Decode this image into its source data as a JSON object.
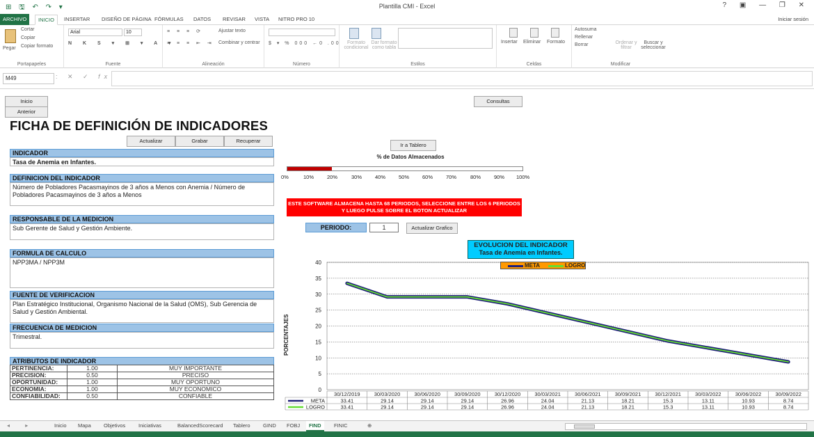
{
  "window": {
    "title": "Plantilla CMI - Excel",
    "sign_in": "Iniciar sesión",
    "controls": "? ▣ — ❐ ✕"
  },
  "quick_access": "⊞ 🖫 ↶ ↷ ▾",
  "ribbon_tabs": [
    "ARCHIVO",
    "INICIO",
    "INSERTAR",
    "DISEÑO DE PÁGINA",
    "FÓRMULAS",
    "DATOS",
    "REVISAR",
    "VISTA",
    "NITRO PRO 10"
  ],
  "ribbon": {
    "clipboard": {
      "paste": "Pegar",
      "cut": "Cortar",
      "copy": "Copiar",
      "format_painter": "Copiar formato",
      "label": "Portapapeles"
    },
    "font": {
      "name": "Arial",
      "size": "10",
      "label": "Fuente"
    },
    "alignment": {
      "wrap": "Ajustar texto",
      "merge": "Combinar y centrar",
      "label": "Alineación"
    },
    "number": {
      "label": "Número"
    },
    "styles": {
      "cond": "Formato condicional",
      "table": "Dar formato como tabla",
      "label": "Estilos"
    },
    "cells": {
      "insert": "Insertar",
      "delete": "Eliminar",
      "format": "Formato",
      "label": "Celdas"
    },
    "editing": {
      "autosum": "Autosuma",
      "fill": "Rellenar",
      "clear": "Borrar",
      "sort": "Ordenar y filtrar",
      "find": "Buscar y seleccionar",
      "label": "Modificar"
    }
  },
  "formula_bar": {
    "cell_ref": "M49",
    "fx": "fx",
    "value": ""
  },
  "sheet": {
    "btn_inicio": "Inicio",
    "btn_anterior": "Anterior",
    "btn_consultas": "Consultas",
    "title": "FICHA DE DEFINICIÓN DE INDICADORES",
    "btn_actualizar": "Actualizar",
    "btn_grabar": "Grabar",
    "btn_recuperar": "Recuperar",
    "btn_ir_tablero": "Ir a Tablero",
    "indicador_hdr": "INDICADOR",
    "indicador_val": "Tasa de Anemia en Infantes.",
    "definicion_hdr": "DEFINICION DEL INDICADOR",
    "definicion_val": "Número de Pobladores Pacasmayinos de 3 años a Menos con Anemia / Número de Pobladores Pacasmayinos de 3 años a Menos",
    "responsable_hdr": "RESPONSABLE DE LA MEDICION",
    "responsable_val": "Sub Gerente de Salud y Gestión Ambiente.",
    "formula_hdr": "FORMULA DE CALCULO",
    "formula_val": "NPP3MA / NPP3M",
    "fuente_hdr": "FUENTE DE VERIFICACION",
    "fuente_val": "Plan Estratégico Institucional, Organismo Nacional de la Salud (OMS), Sub Gerencia de Salud y Gestión Ambiental.",
    "frecuencia_hdr": "FRECUENCIA DE MEDICION",
    "frecuencia_val": "Trimestral.",
    "atributos_hdr": "ATRIBUTOS DE INDICADOR",
    "atributos": [
      {
        "k": "PERTINENCIA:",
        "n": "1.00",
        "d": "MUY IMPORTANTE"
      },
      {
        "k": "PRECISION:",
        "n": "0.50",
        "d": "PRECISO"
      },
      {
        "k": "OPORTUNIDAD:",
        "n": "1.00",
        "d": "MUY OPORTUNO"
      },
      {
        "k": "ECONOMIA:",
        "n": "1.00",
        "d": "MUY ECONOMICO"
      },
      {
        "k": "CONFIABILIDAD:",
        "n": "0.50",
        "d": "CONFIABLE"
      }
    ],
    "pct_title": "% de Datos Almacenados",
    "pct_ticks": [
      "0%",
      "10%",
      "20%",
      "30%",
      "40%",
      "50%",
      "60%",
      "70%",
      "80%",
      "90%",
      "100%"
    ],
    "pct_stored": 0.19,
    "warning": "ESTE SOFTWARE ALMACENA HASTA 68 PERIODOS, SELECCIONE ENTRE LOS 6 PERIODOS Y LUEGO PULSE SOBRE EL BOTON ACTUALIZAR",
    "periodo_label": "PERIODO:",
    "periodo_value": "1",
    "btn_actualizar_grafico": "Actualizar Grafico"
  },
  "chart_data": {
    "type": "line",
    "title": "EVOLUCION DEL INDICADOR",
    "subtitle": "Tasa de Anemia en Infantes.",
    "ylabel": "PORCENTAJES",
    "xlabel": "",
    "ylim": [
      0,
      40
    ],
    "yticks": [
      0,
      5,
      10,
      15,
      20,
      25,
      30,
      35,
      40
    ],
    "grid": true,
    "legend_position": "top",
    "categories": [
      "30/12/2019",
      "30/03/2020",
      "30/06/2020",
      "30/09/2020",
      "30/12/2020",
      "30/03/2021",
      "30/06/2021",
      "30/09/2021",
      "30/12/2021",
      "30/03/2022",
      "30/06/2022",
      "30/09/2022"
    ],
    "series": [
      {
        "name": "META",
        "color": "#1f1f7a",
        "labels": [
          "33.41",
          "29.14",
          "29.14",
          "29.14",
          "26.96",
          "24.04",
          "21.13",
          "18.21",
          "15.3",
          "13.11",
          "10.93",
          "8.74"
        ],
        "values": [
          33.41,
          29.14,
          29.14,
          29.14,
          26.96,
          24.04,
          21.13,
          18.21,
          15.3,
          13.11,
          10.93,
          8.74
        ]
      },
      {
        "name": "LOGRO",
        "color": "#66dd33",
        "labels": [
          "33.41",
          "29.14",
          "29.14",
          "29.14",
          "26.96",
          "24.04",
          "21.13",
          "18.21",
          "15.3",
          "13.11",
          "10.93",
          "8.74"
        ],
        "values": [
          33.41,
          29.14,
          29.14,
          29.14,
          26.96,
          24.04,
          21.13,
          18.21,
          15.3,
          13.11,
          10.93,
          8.74
        ]
      }
    ]
  },
  "sheet_tabs": [
    "Inicio",
    "Mapa",
    "Objetivos",
    "Iniciativas",
    "BalancedScorecard",
    "Tablero",
    "GIND",
    "FOBJ",
    "FIND",
    "FINIC"
  ],
  "active_sheet": "FIND",
  "colors": {
    "excel_green": "#217346",
    "header_blue": "#9dc3e6",
    "warning_red": "#ff0000",
    "chart_title_bg": "#00ccff",
    "legend_bg": "#ff9900"
  }
}
